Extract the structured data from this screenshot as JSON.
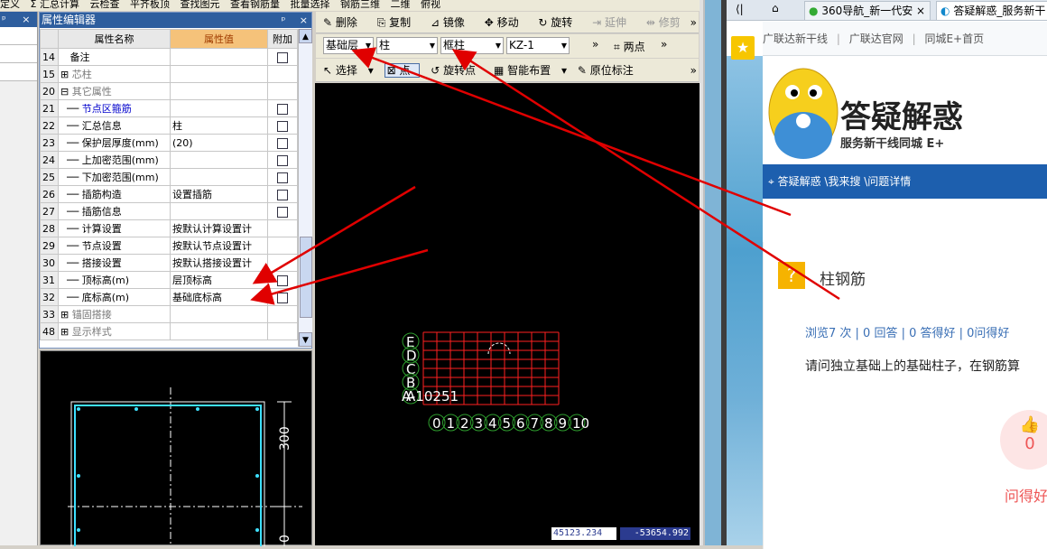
{
  "topbar": {
    "items": [
      "定义",
      "Σ 汇总计算",
      "云检查",
      "平齐板顶",
      "查找图元",
      "查看钢筋量",
      "批量选择",
      "钢筋三维",
      "二维",
      "俯视"
    ]
  },
  "left_panel": {
    "close": "×",
    "pin": "ᵖ"
  },
  "property_editor": {
    "title": "属性编辑器",
    "pin": "ᵖ",
    "close": "×",
    "headers": {
      "num": "",
      "name": "属性名称",
      "value": "属性值",
      "attach": "附加"
    },
    "rows": [
      {
        "num": "14",
        "name": "备注",
        "value": "",
        "check": true,
        "kind": "plain"
      },
      {
        "num": "15",
        "name": "芯柱",
        "value": "",
        "check": false,
        "kind": "group-plus"
      },
      {
        "num": "20",
        "name": "其它属性",
        "value": "",
        "check": false,
        "kind": "group-minus"
      },
      {
        "num": "21",
        "name": "节点区箍筋",
        "value": "",
        "check": true,
        "kind": "child-blue"
      },
      {
        "num": "22",
        "name": "汇总信息",
        "value": "柱",
        "check": true,
        "kind": "child"
      },
      {
        "num": "23",
        "name": "保护层厚度(mm)",
        "value": "(20)",
        "check": true,
        "kind": "child"
      },
      {
        "num": "24",
        "name": "上加密范围(mm)",
        "value": "",
        "check": true,
        "kind": "child"
      },
      {
        "num": "25",
        "name": "下加密范围(mm)",
        "value": "",
        "check": true,
        "kind": "child"
      },
      {
        "num": "26",
        "name": "插筋构造",
        "value": "设置插筋",
        "check": true,
        "kind": "child"
      },
      {
        "num": "27",
        "name": "插筋信息",
        "value": "",
        "check": true,
        "kind": "child"
      },
      {
        "num": "28",
        "name": "计算设置",
        "value": "按默认计算设置计",
        "check": false,
        "kind": "child"
      },
      {
        "num": "29",
        "name": "节点设置",
        "value": "按默认节点设置计",
        "check": false,
        "kind": "child"
      },
      {
        "num": "30",
        "name": "搭接设置",
        "value": "按默认搭接设置计",
        "check": false,
        "kind": "child"
      },
      {
        "num": "31",
        "name": "顶标高(m)",
        "value": "层顶标高",
        "check": true,
        "kind": "child"
      },
      {
        "num": "32",
        "name": "底标高(m)",
        "value": "基础底标高",
        "check": true,
        "kind": "child"
      },
      {
        "num": "33",
        "name": "锚固搭接",
        "value": "",
        "check": false,
        "kind": "group-plus"
      },
      {
        "num": "48",
        "name": "显示样式",
        "value": "",
        "check": false,
        "kind": "group-plus"
      }
    ]
  },
  "preview": {
    "dim_label": "300",
    "dim_label2": "0"
  },
  "cad_toolbar1": {
    "delete": "删除",
    "copy": "复制",
    "mirror": "镜像",
    "move": "移动",
    "rotate": "旋转",
    "extend": "延伸",
    "trim": "修剪",
    "more": "»"
  },
  "cad_toolbar2": {
    "floor": "基础层",
    "category": "柱",
    "type": "框柱",
    "name": "KZ-1",
    "twopoint": "两点",
    "more": "»"
  },
  "cad_toolbar3": {
    "select": "选择",
    "point": "点",
    "rotate_point": "旋转点",
    "smart": "智能布置",
    "origin_mark": "原位标注",
    "more": "»"
  },
  "cad": {
    "row_labels": [
      "E",
      "D",
      "C",
      "B",
      "A"
    ],
    "axis_label": "A-10251",
    "col_numbers": [
      "0",
      "1",
      "2",
      "3",
      "4",
      "5",
      "6",
      "7",
      "8",
      "9",
      "10"
    ],
    "coord_x": "45123.234",
    "coord_y": "-53654.992"
  },
  "browser": {
    "tabs": [
      {
        "label": "360导航_新一代安",
        "close": "×"
      },
      {
        "label": "答疑解惑_服务新干",
        "close": ""
      }
    ],
    "nav_back": "⟨|",
    "favorites": [
      "广联达新干线",
      "广联达官网",
      "同城E+首页"
    ],
    "logo_title": "答疑解惑",
    "logo_sub": "服务新干线同城 E+",
    "breadcrumb": "答疑解惑 \\我来搜 \\问题详情",
    "question_title": "柱钢筋",
    "meta": "浏览7 次 | 0 回答 | 0 答得好 | 0问得好",
    "body": "请问独立基础上的基础柱子，在钢筋算",
    "likes": "0",
    "helpful": "问得好"
  },
  "colors": {
    "titlebar": "#2e5e9e",
    "value_header": "#f5c27a",
    "arrow": "#e00000",
    "grid_red": "#ff2020",
    "bubble_green": "#2e9e2e",
    "bluebar": "#1d5fae"
  }
}
